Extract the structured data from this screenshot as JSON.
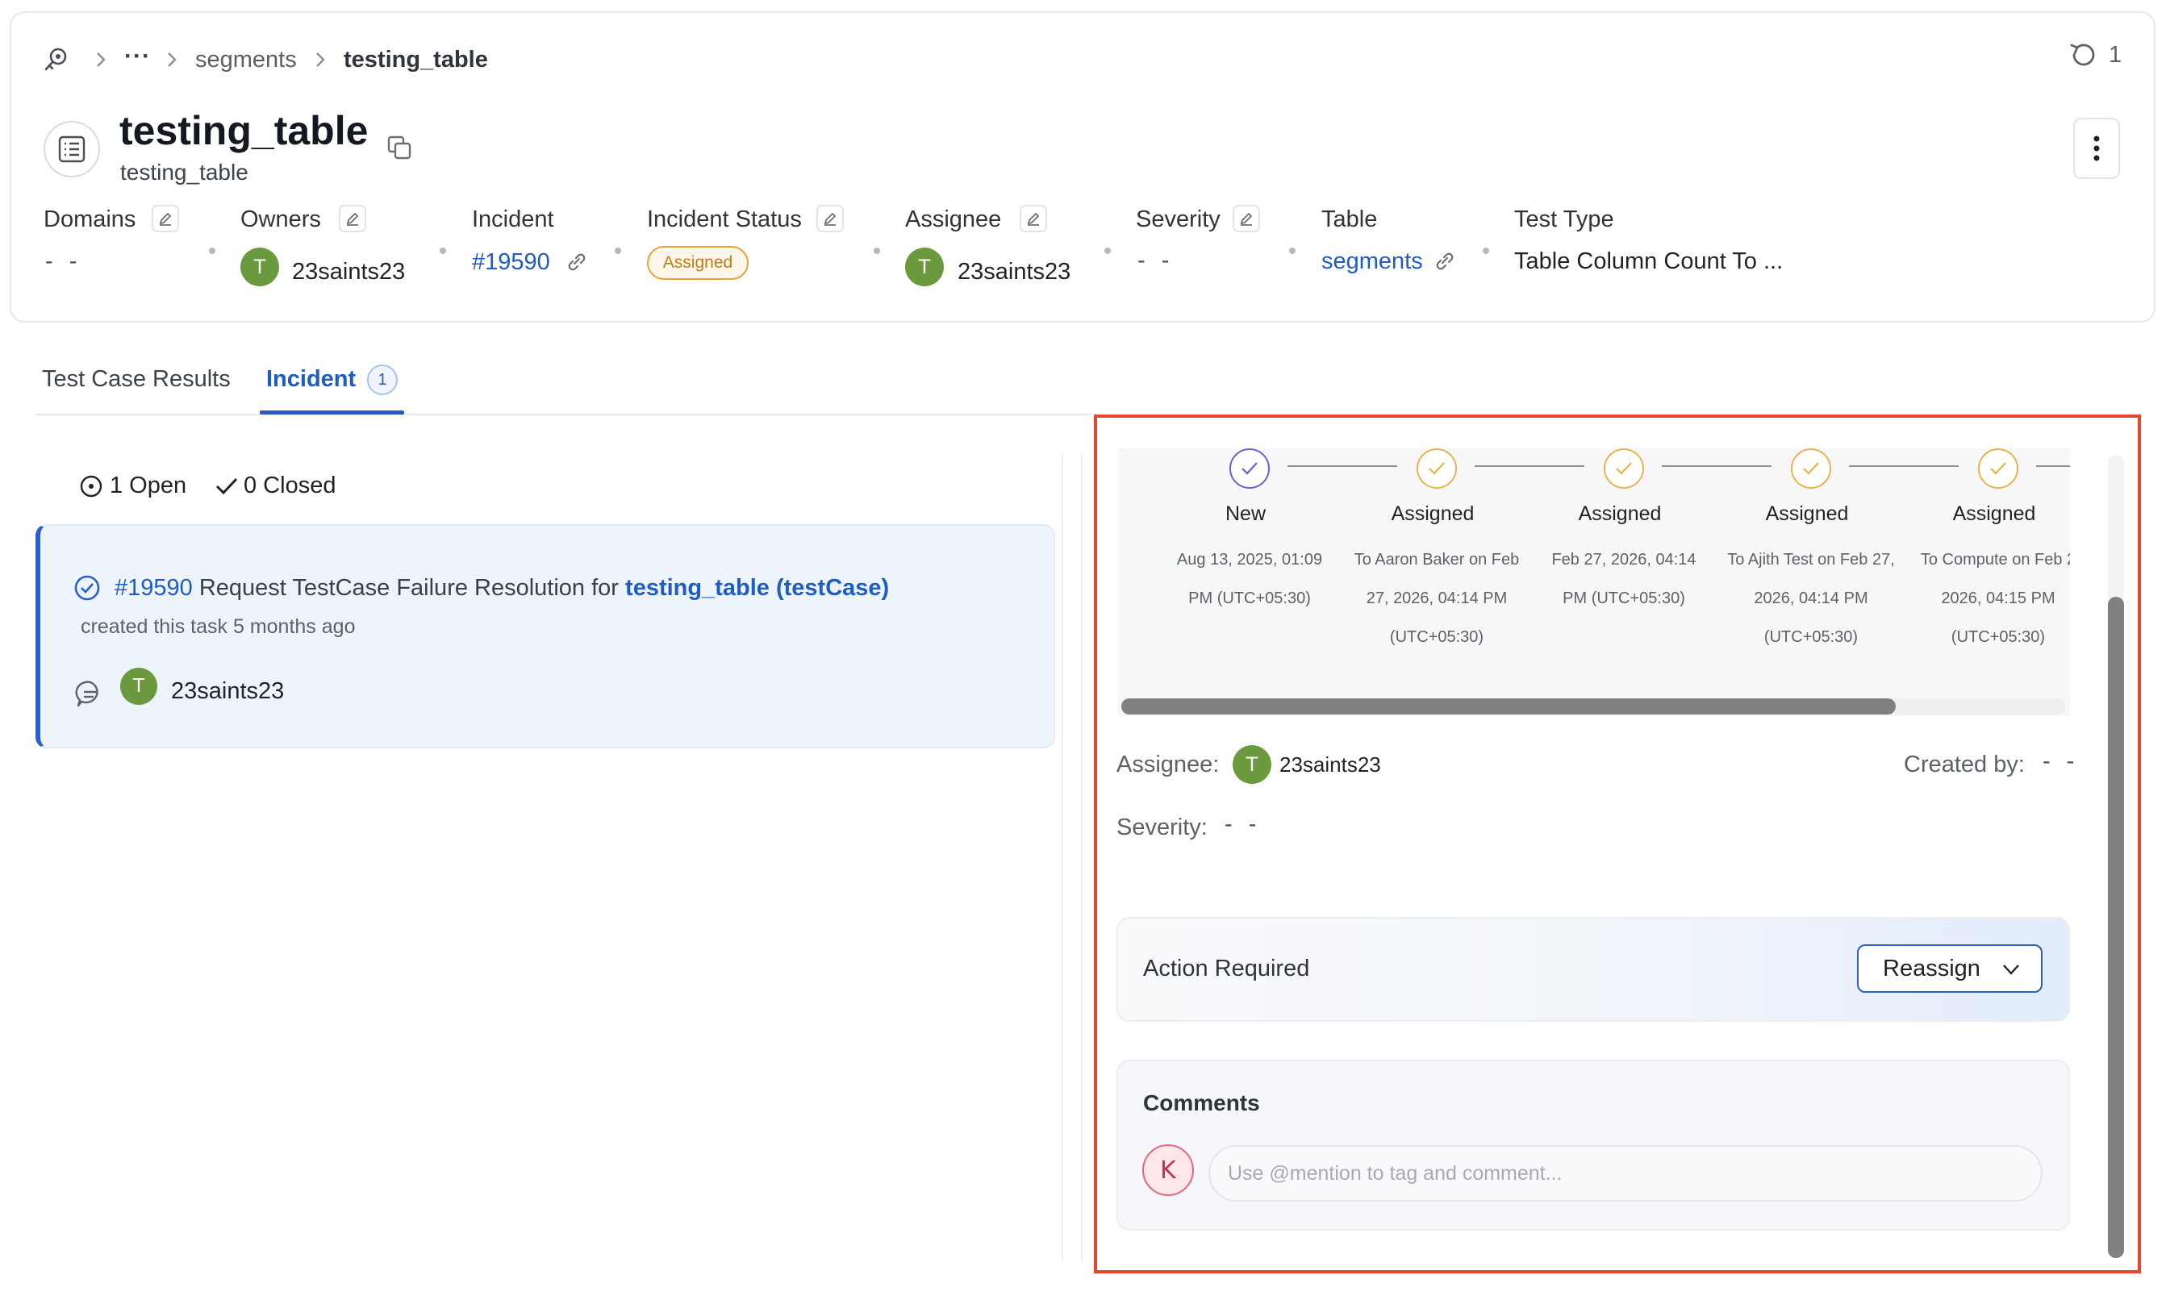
{
  "breadcrumb": {
    "ellipsis": "···",
    "items": [
      "segments",
      "testing_table"
    ]
  },
  "history": {
    "count": "1"
  },
  "entity": {
    "title": "testing_table",
    "subtitle": "testing_table"
  },
  "meta": {
    "domains": {
      "label": "Domains",
      "value": "- -"
    },
    "owners": {
      "label": "Owners",
      "avatar": "T",
      "value": "23saints23"
    },
    "incident": {
      "label": "Incident",
      "value": "#19590"
    },
    "incident_status": {
      "label": "Incident Status",
      "value": "Assigned"
    },
    "assignee": {
      "label": "Assignee",
      "avatar": "T",
      "value": "23saints23"
    },
    "severity": {
      "label": "Severity",
      "value": "- -"
    },
    "table": {
      "label": "Table",
      "value": "segments"
    },
    "test_type": {
      "label": "Test Type",
      "value": "Table Column Count To ..."
    }
  },
  "tabs": [
    {
      "label": "Test Case Results"
    },
    {
      "label": "Incident",
      "count": "1"
    }
  ],
  "filters": {
    "open": "1 Open",
    "closed": "0 Closed"
  },
  "task": {
    "number": "#19590",
    "text": "Request TestCase Failure Resolution for",
    "entity": "testing_table (testCase)",
    "meta": "created this task 5 months ago",
    "avatar": "T",
    "user": "23saints23"
  },
  "timeline": [
    {
      "status": "New",
      "line1": "Aug 13, 2025, 01:09",
      "line2": "PM (UTC+05:30)",
      "line3": ""
    },
    {
      "status": "Assigned",
      "line1": "To Aaron Baker on Feb",
      "line2": "27, 2026, 04:14 PM",
      "line3": "(UTC+05:30)"
    },
    {
      "status": "Assigned",
      "line1": "Feb 27, 2026, 04:14",
      "line2": "PM (UTC+05:30)",
      "line3": ""
    },
    {
      "status": "Assigned",
      "line1": "To Ajith Test on Feb 27,",
      "line2": "2026, 04:14 PM",
      "line3": "(UTC+05:30)"
    },
    {
      "status": "Assigned",
      "line1": "To Compute on Feb 2",
      "line2": "2026, 04:15 PM",
      "line3": "(UTC+05:30)"
    }
  ],
  "details": {
    "assignee_label": "Assignee:",
    "assignee_avatar": "T",
    "assignee_value": "23saints23",
    "created_by_label": "Created by:",
    "created_by_value": "- -",
    "severity_label": "Severity:",
    "severity_value": "- -"
  },
  "action": {
    "title": "Action Required",
    "button": "Reassign"
  },
  "comments": {
    "title": "Comments",
    "avatar": "K",
    "placeholder": "Use @mention to tag and comment..."
  },
  "colors": {
    "accent": "#1f5cc4",
    "assigned_orange": "#e8a23c",
    "new_purple": "#6b5fd3",
    "avatar_green": "#6b9a3e",
    "highlight_red": "#e8452f"
  }
}
